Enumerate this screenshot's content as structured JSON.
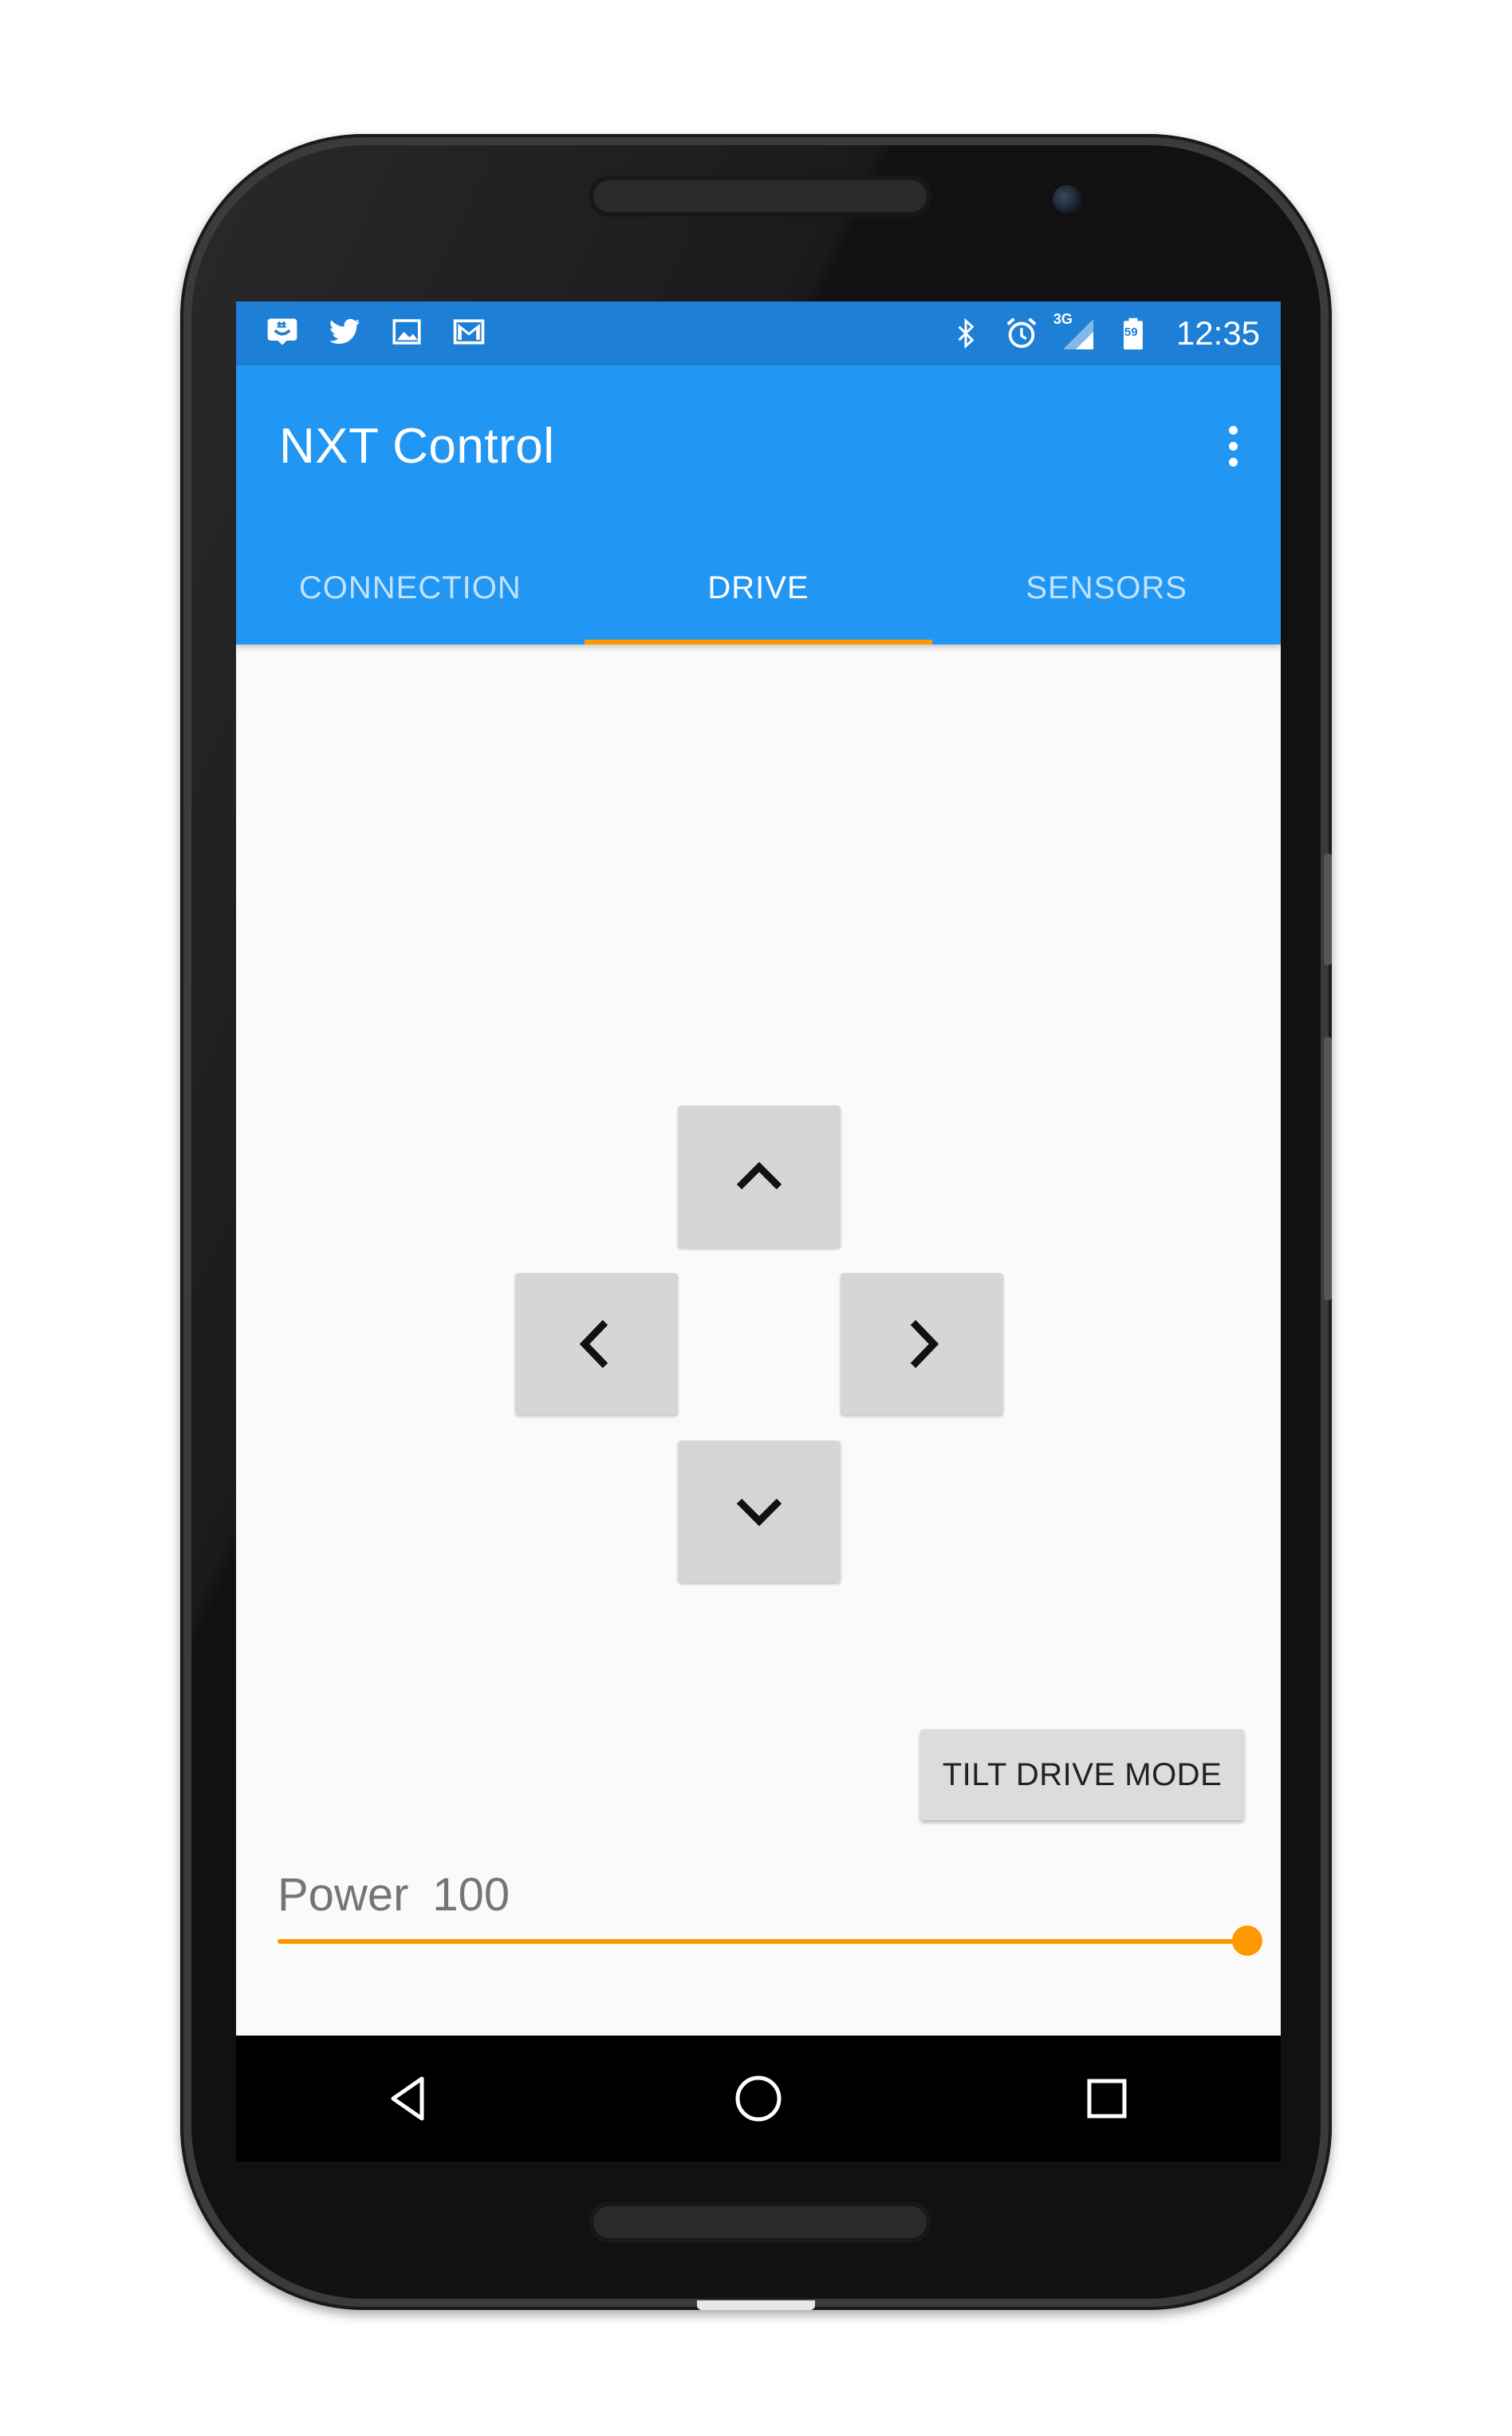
{
  "status_bar": {
    "time": "12:35",
    "left_icons": [
      "groupme-icon",
      "twitter-icon",
      "gallery-icon",
      "gmail-icon"
    ],
    "right_icons": [
      "bluetooth-icon",
      "alarm-icon",
      "signal-3g-icon",
      "battery-icon"
    ],
    "network_label": "3G",
    "battery_level": "59"
  },
  "app_bar": {
    "title": "NXT Control",
    "overflow_icon": "more-vert-icon"
  },
  "tabs": [
    {
      "label": "CONNECTION",
      "active": false
    },
    {
      "label": "DRIVE",
      "active": true
    },
    {
      "label": "SENSORS",
      "active": false
    }
  ],
  "drive": {
    "dpad": {
      "up_icon": "chevron-up-icon",
      "left_icon": "chevron-left-icon",
      "right_icon": "chevron-right-icon",
      "down_icon": "chevron-down-icon"
    },
    "tilt_button_label": "TILT DRIVE MODE",
    "power_label": "Power",
    "power_value": "100",
    "power_fraction": 1.0
  },
  "nav_bar": {
    "back_icon": "back-triangle-icon",
    "home_icon": "home-circle-icon",
    "recents_icon": "recents-square-icon"
  },
  "colors": {
    "status_bar": "#1e7fd6",
    "app_bar": "#2196f3",
    "accent": "#ff9800",
    "button_bg": "#d6d6d6",
    "screen_bg": "#fafafa"
  }
}
